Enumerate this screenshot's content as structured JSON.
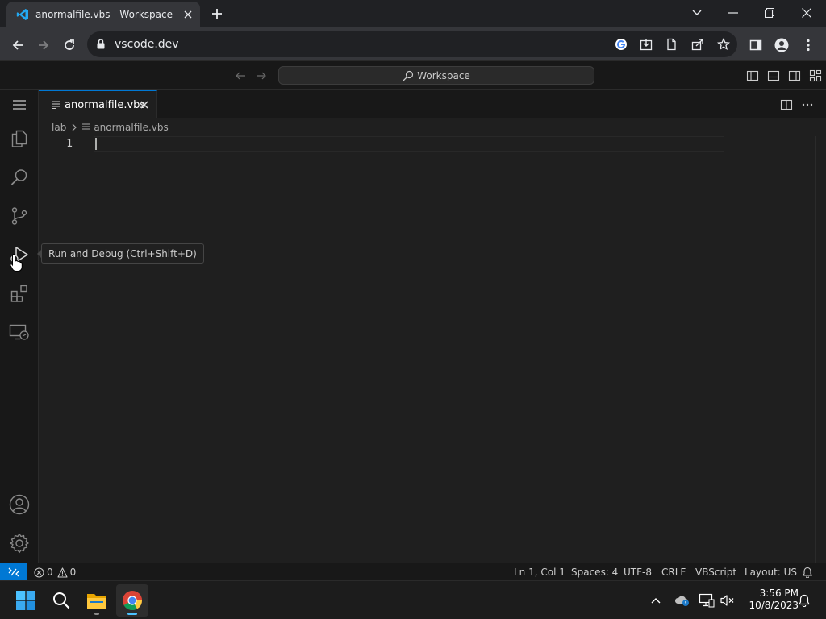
{
  "browser": {
    "tab_title": "anormalfile.vbs - Workspace - Visual Studio Code",
    "url": "vscode.dev"
  },
  "vscode": {
    "command_center": "Workspace",
    "editor_tab": "anormalfile.vbs",
    "breadcrumb": [
      "lab",
      "anormalfile.vbs"
    ],
    "line_numbers": [
      "1"
    ],
    "tooltip": "Run and Debug (Ctrl+Shift+D)",
    "activity_items": [
      "Explorer",
      "Search",
      "Source Control",
      "Run and Debug",
      "Extensions",
      "Remote Explorer",
      "Accounts",
      "Manage"
    ]
  },
  "statusbar": {
    "errors": "0",
    "warnings": "0",
    "position": "Ln 1, Col 1",
    "spaces": "Spaces: 4",
    "encoding": "UTF-8",
    "eol": "CRLF",
    "language": "VBScript",
    "layout": "Layout: US"
  },
  "taskbar": {
    "time": "3:56 PM",
    "date": "10/8/2023"
  },
  "colors": {
    "accent": "#0078d4",
    "editor_bg": "#1f1f1f",
    "chrome_bg": "#35363a"
  }
}
